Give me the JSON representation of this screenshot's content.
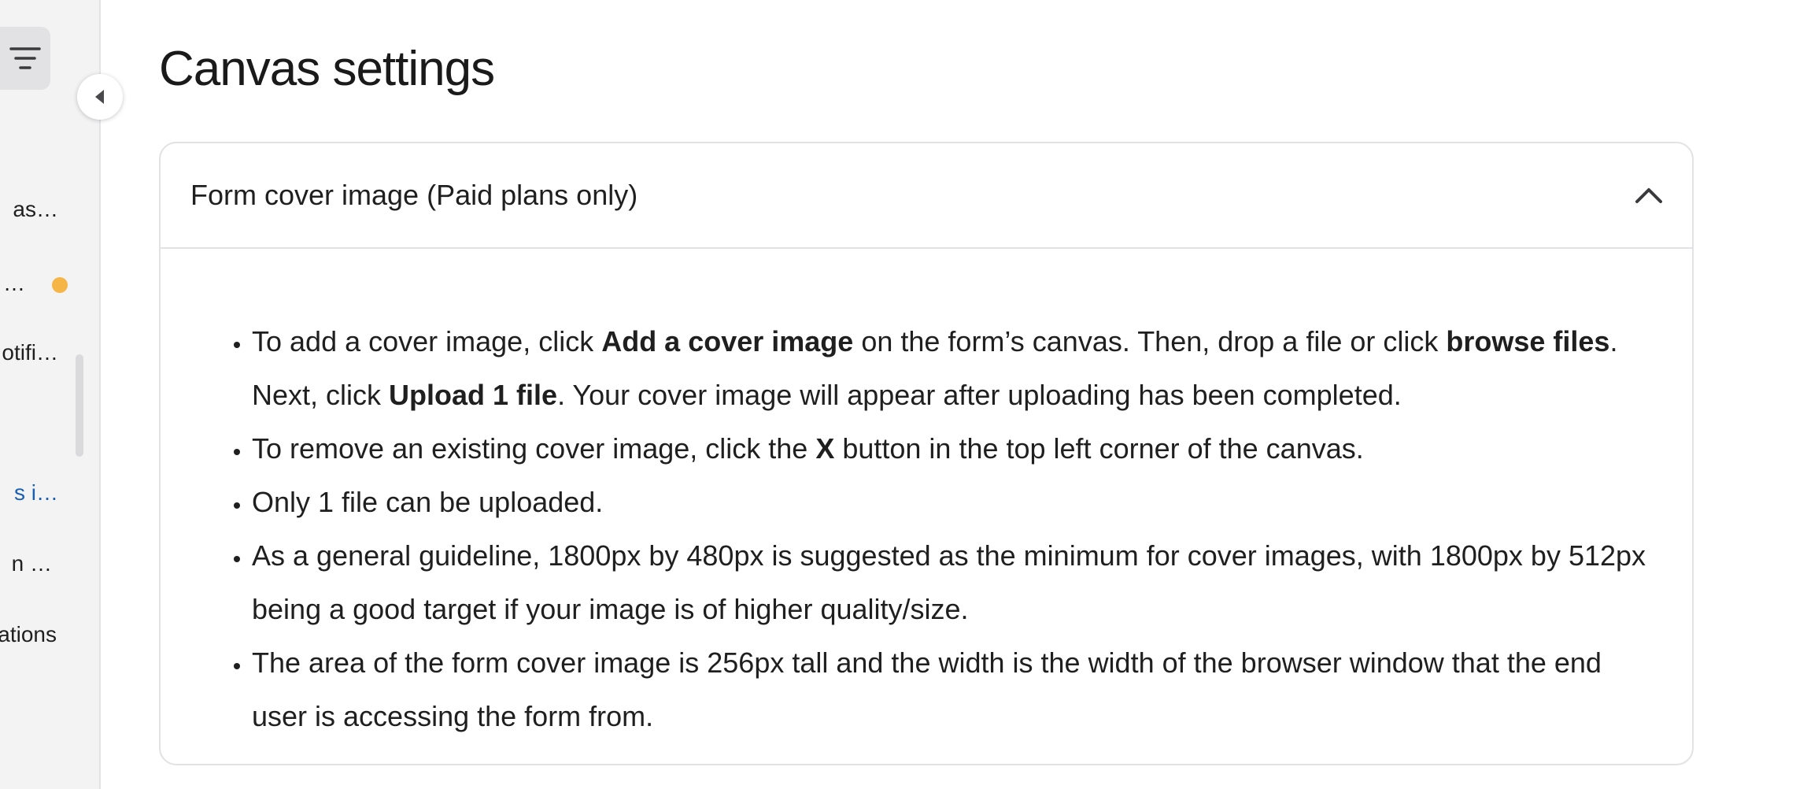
{
  "sidebar": {
    "items": [
      {
        "label": "as…",
        "active": false
      },
      {
        "label": "…",
        "active": false,
        "has_status_dot": true
      },
      {
        "label": "otifi…",
        "active": false
      },
      {
        "label": "s i…",
        "active": true
      },
      {
        "label": "n …",
        "active": false
      },
      {
        "label": "ations",
        "active": false
      }
    ],
    "status_dot_color": "#f6b547",
    "menu_icon": "filter-lines-icon",
    "collapse_icon": "caret-left-icon"
  },
  "page": {
    "title": "Canvas settings"
  },
  "accordion": {
    "title": "Form cover image (Paid plans only)",
    "expanded": true,
    "toggle_icon": "chevron-up-icon",
    "bullets": [
      {
        "t1": "To add a cover image, click ",
        "b1": "Add a cover image",
        "t2": " on the form’s canvas. Then, drop a file or click ",
        "b2": "browse files",
        "t3": ". Next, click ",
        "b3": "Upload 1 file",
        "t4": ". Your cover image will appear after uploading has been completed."
      },
      {
        "t1": "To remove an existing cover image, click the ",
        "b1": "X",
        "t2": " button in the top left corner of the canvas."
      },
      {
        "t1": "Only 1 file can be uploaded."
      },
      {
        "t1": "As a general guideline, 1800px by 480px is suggested as the minimum for cover images, with 1800px by 512px being a good target if your image is of higher quality/size."
      },
      {
        "t1": "The area of the form cover image is 256px tall and the width is the width of the browser window that the end user is accessing the form from."
      }
    ]
  },
  "colors": {
    "link": "#1a5fb4",
    "sidebar_bg": "#f3f3f4",
    "border": "#e2e2e5"
  }
}
